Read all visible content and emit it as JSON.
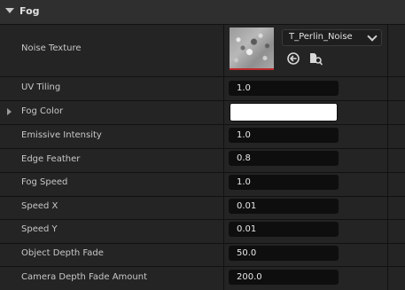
{
  "section": {
    "title": "Fog"
  },
  "noise_texture": {
    "label": "Noise Texture",
    "asset_name": "T_Perlin_Noise",
    "icons": [
      "use-selected-icon",
      "browse-asset-icon"
    ]
  },
  "properties": [
    {
      "label": "UV Tiling",
      "value": "1.0"
    },
    {
      "label": "Fog Color",
      "value_color": "#ffffff",
      "expandable": true
    },
    {
      "label": "Emissive Intensity",
      "value": "1.0"
    },
    {
      "label": "Edge Feather",
      "value": "0.8"
    },
    {
      "label": "Fog Speed",
      "value": "1.0"
    },
    {
      "label": "Speed X",
      "value": "0.01"
    },
    {
      "label": "Speed Y",
      "value": "0.01"
    },
    {
      "label": "Object Depth Fade",
      "value": "50.0"
    },
    {
      "label": "Camera Depth Fade Amount",
      "value": "200.0"
    }
  ],
  "colors": {
    "background": "#1a1a1a",
    "row": "#242424",
    "header": "#2f2f2f",
    "field": "#0e0e0e",
    "thumbnail_accent": "#c0282a"
  }
}
